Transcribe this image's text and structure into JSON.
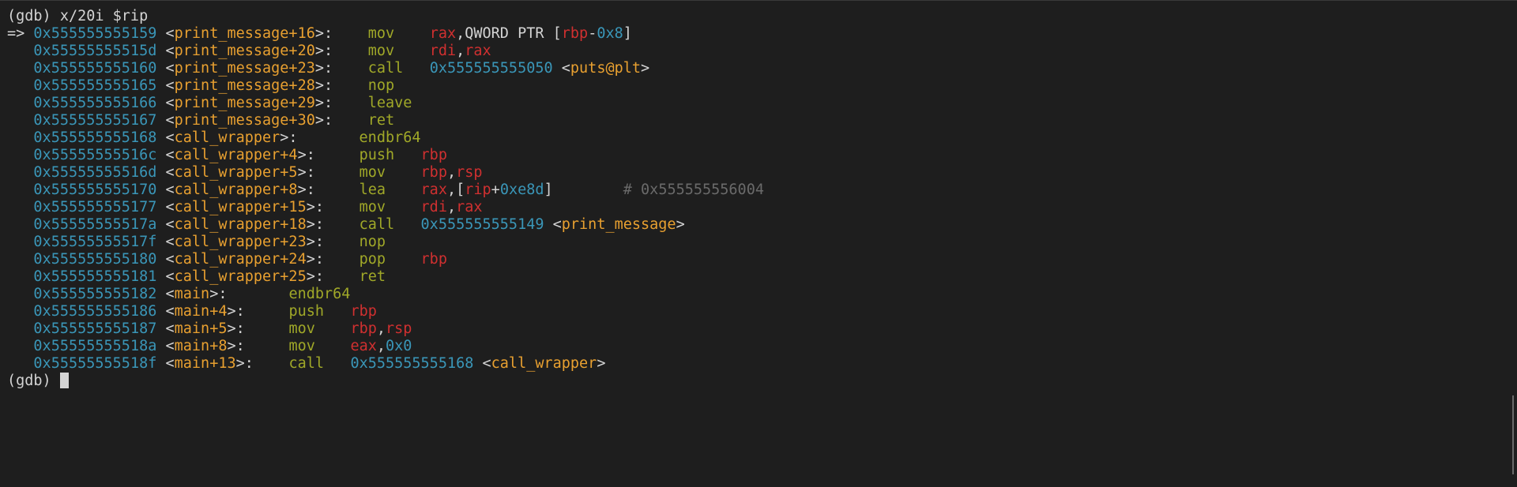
{
  "terminal": {
    "command_line": "(gdb) x/20i $rip",
    "prompt": "(gdb) ",
    "current_arrow": "=>",
    "rows": [
      {
        "addr": "0x555555555159",
        "sym": "print_message+16",
        "mnem": "mov",
        "ops": [
          {
            "t": "reg",
            "v": "rax"
          },
          {
            "t": "txt",
            "v": ",QWORD PTR ["
          },
          {
            "t": "reg",
            "v": "rbp"
          },
          {
            "t": "txt",
            "v": "-"
          },
          {
            "t": "imm",
            "v": "0x8"
          },
          {
            "t": "txt",
            "v": "]"
          }
        ],
        "comment": ""
      },
      {
        "addr": "0x55555555515d",
        "sym": "print_message+20",
        "mnem": "mov",
        "ops": [
          {
            "t": "reg",
            "v": "rdi"
          },
          {
            "t": "txt",
            "v": ","
          },
          {
            "t": "reg",
            "v": "rax"
          }
        ],
        "comment": ""
      },
      {
        "addr": "0x555555555160",
        "sym": "print_message+23",
        "mnem": "call",
        "ops": [
          {
            "t": "imm",
            "v": "0x555555555050"
          },
          {
            "t": "txt",
            "v": " <"
          },
          {
            "t": "sym",
            "v": "puts@plt"
          },
          {
            "t": "txt",
            "v": ">"
          }
        ],
        "comment": ""
      },
      {
        "addr": "0x555555555165",
        "sym": "print_message+28",
        "mnem": "nop",
        "ops": [],
        "comment": ""
      },
      {
        "addr": "0x555555555166",
        "sym": "print_message+29",
        "mnem": "leave",
        "ops": [],
        "comment": ""
      },
      {
        "addr": "0x555555555167",
        "sym": "print_message+30",
        "mnem": "ret",
        "ops": [],
        "comment": ""
      },
      {
        "addr": "0x555555555168",
        "sym": "call_wrapper",
        "mnem": "endbr64",
        "ops": [],
        "comment": ""
      },
      {
        "addr": "0x55555555516c",
        "sym": "call_wrapper+4",
        "mnem": "push",
        "ops": [
          {
            "t": "reg",
            "v": "rbp"
          }
        ],
        "comment": ""
      },
      {
        "addr": "0x55555555516d",
        "sym": "call_wrapper+5",
        "mnem": "mov",
        "ops": [
          {
            "t": "reg",
            "v": "rbp"
          },
          {
            "t": "txt",
            "v": ","
          },
          {
            "t": "reg",
            "v": "rsp"
          }
        ],
        "comment": ""
      },
      {
        "addr": "0x555555555170",
        "sym": "call_wrapper+8",
        "mnem": "lea",
        "ops": [
          {
            "t": "reg",
            "v": "rax"
          },
          {
            "t": "txt",
            "v": ",["
          },
          {
            "t": "reg",
            "v": "rip"
          },
          {
            "t": "txt",
            "v": "+"
          },
          {
            "t": "imm",
            "v": "0xe8d"
          },
          {
            "t": "txt",
            "v": "]"
          }
        ],
        "comment": "# 0x555555556004"
      },
      {
        "addr": "0x555555555177",
        "sym": "call_wrapper+15",
        "mnem": "mov",
        "ops": [
          {
            "t": "reg",
            "v": "rdi"
          },
          {
            "t": "txt",
            "v": ","
          },
          {
            "t": "reg",
            "v": "rax"
          }
        ],
        "comment": ""
      },
      {
        "addr": "0x55555555517a",
        "sym": "call_wrapper+18",
        "mnem": "call",
        "ops": [
          {
            "t": "imm",
            "v": "0x555555555149"
          },
          {
            "t": "txt",
            "v": " <"
          },
          {
            "t": "sym",
            "v": "print_message"
          },
          {
            "t": "txt",
            "v": ">"
          }
        ],
        "comment": ""
      },
      {
        "addr": "0x55555555517f",
        "sym": "call_wrapper+23",
        "mnem": "nop",
        "ops": [],
        "comment": ""
      },
      {
        "addr": "0x555555555180",
        "sym": "call_wrapper+24",
        "mnem": "pop",
        "ops": [
          {
            "t": "reg",
            "v": "rbp"
          }
        ],
        "comment": ""
      },
      {
        "addr": "0x555555555181",
        "sym": "call_wrapper+25",
        "mnem": "ret",
        "ops": [],
        "comment": ""
      },
      {
        "addr": "0x555555555182",
        "sym": "main",
        "mnem": "endbr64",
        "ops": [],
        "comment": ""
      },
      {
        "addr": "0x555555555186",
        "sym": "main+4",
        "mnem": "push",
        "ops": [
          {
            "t": "reg",
            "v": "rbp"
          }
        ],
        "comment": ""
      },
      {
        "addr": "0x555555555187",
        "sym": "main+5",
        "mnem": "mov",
        "ops": [
          {
            "t": "reg",
            "v": "rbp"
          },
          {
            "t": "txt",
            "v": ","
          },
          {
            "t": "reg",
            "v": "rsp"
          }
        ],
        "comment": ""
      },
      {
        "addr": "0x55555555518a",
        "sym": "main+8",
        "mnem": "mov",
        "ops": [
          {
            "t": "reg",
            "v": "eax"
          },
          {
            "t": "txt",
            "v": ","
          },
          {
            "t": "imm",
            "v": "0x0"
          }
        ],
        "comment": ""
      },
      {
        "addr": "0x55555555518f",
        "sym": "main+13",
        "mnem": "call",
        "ops": [
          {
            "t": "imm",
            "v": "0x555555555168"
          },
          {
            "t": "txt",
            "v": " <"
          },
          {
            "t": "sym",
            "v": "call_wrapper"
          },
          {
            "t": "txt",
            "v": ">"
          }
        ],
        "comment": ""
      }
    ]
  },
  "colors": {
    "background": "#1e1e1e",
    "address": "#3a96b8",
    "symbol": "#e8a030",
    "mnemonic": "#a0a828",
    "register": "#d03030",
    "comment": "#6a6a6a",
    "text": "#d4d4d4"
  }
}
